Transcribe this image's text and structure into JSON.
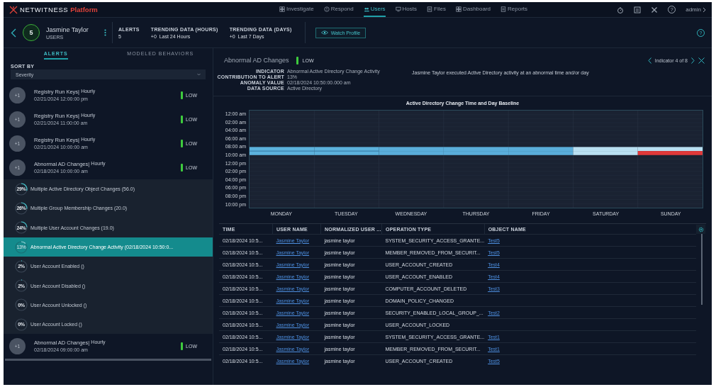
{
  "nav": {
    "logo_main": "NETWITNESS",
    "logo_accent": "Platform",
    "items": [
      {
        "label": "Investigate",
        "selected": false
      },
      {
        "label": "Respond",
        "selected": false
      },
      {
        "label": "Users",
        "selected": true
      },
      {
        "label": "Hosts",
        "selected": false
      },
      {
        "label": "Files",
        "selected": false
      },
      {
        "label": "Dashboard",
        "selected": false
      },
      {
        "label": "Reports",
        "selected": false
      }
    ],
    "help": "?",
    "user": "admin"
  },
  "profile": {
    "score": "5",
    "name": "Jasmine Taylor",
    "type": "USERS",
    "stats": [
      {
        "label": "ALERTS",
        "value": "5"
      },
      {
        "label": "TRENDING DATA (HOURS)",
        "value": "+0  Last 24 Hours"
      },
      {
        "label": "TRENDING DATA (DAYS)",
        "value": "+0  Last 7 Days"
      }
    ],
    "watch_button": "Watch Profile",
    "help": "?"
  },
  "left": {
    "tabs": [
      {
        "label": "ALERTS",
        "selected": true
      },
      {
        "label": "MODELED BEHAVIORS",
        "selected": false
      }
    ],
    "sort_label": "SORT BY",
    "sort_value": "Severity",
    "alerts": [
      {
        "badge": "+1",
        "name": "Registry Run Keys|",
        "frequency": "Hourly",
        "date": "02/21/2024 12:00:00 pm",
        "severity": "LOW"
      },
      {
        "badge": "+1",
        "name": "Registry Run Keys|",
        "frequency": "Hourly",
        "date": "02/21/2024 11:00:00 am",
        "severity": "LOW"
      },
      {
        "badge": "+1",
        "name": "Registry Run Keys|",
        "frequency": "Hourly",
        "date": "02/21/2024 10:00:00 am",
        "severity": "LOW"
      },
      {
        "badge": "+1",
        "name": "Abnormal AD Changes|",
        "frequency": "Hourly",
        "date": "02/18/2024 10:00:00 am",
        "severity": "LOW",
        "indicators": [
          {
            "percent": "29%",
            "label": "Multiple Active Directory Object Changes (56.0)",
            "selected": false
          },
          {
            "percent": "26%",
            "label": "Multiple Group Membership Changes (20.0)",
            "selected": false
          },
          {
            "percent": "24%",
            "label": "Multiple User Account Changes (19.0)",
            "selected": false
          },
          {
            "percent": "13%",
            "label": "Abnormal Active Directory Change Activity (02/18/2024 10:50:0...",
            "selected": true
          },
          {
            "percent": "2%",
            "label": "User Account Enabled ()",
            "selected": false
          },
          {
            "percent": "2%",
            "label": "User Account Disabled ()",
            "selected": false
          },
          {
            "percent": "0%",
            "label": "User Account Unlocked ()",
            "selected": false
          },
          {
            "percent": "0%",
            "label": "User Account Locked ()",
            "selected": false
          }
        ]
      },
      {
        "badge": "+1",
        "name": "Abnormal AD Changes|",
        "frequency": "Hourly",
        "date": "02/18/2024 09:00:00 am",
        "severity": "LOW"
      }
    ]
  },
  "detail": {
    "title": "Abnormal AD Changes",
    "severity": "LOW",
    "pager": "Indicator 4 of 8",
    "fields": [
      {
        "label": "INDICATOR",
        "value": "Abnormal Active Directory Change Activity"
      },
      {
        "label": "CONTRIBUTION TO ALERT",
        "value": "13%"
      },
      {
        "label": "ANOMALY VALUE",
        "value": "02/18/2024 10:50:00.000 am"
      },
      {
        "label": "DATA SOURCE",
        "value": "Active Directory"
      }
    ],
    "description": "Jasmine Taylor executed Active Directory activity at an abnormal time and/or day",
    "heatmap": {
      "title": "Active Directory Change Time and Day Baseline",
      "y_labels": [
        "12:00 am",
        "02:00 am",
        "04:00 am",
        "06:00 am",
        "08:00 am",
        "10:00 am",
        "12:00 pm",
        "02:00 pm",
        "04:00 pm",
        "06:00 pm",
        "08:00 pm",
        "10:00 pm"
      ],
      "x_labels": [
        "MONDAY",
        "TUESDAY",
        "WEDNESDAY",
        "THURSDAY",
        "FRIDAY",
        "SATURDAY",
        "SUNDAY"
      ]
    },
    "table": {
      "columns": [
        "TIME",
        "USER NAME",
        "NORMALIZED USER ...",
        "OPERATION TYPE",
        "OBJECT NAME"
      ],
      "rows": [
        {
          "time": "02/18/2024 10:5...",
          "user": "Jasmine Taylor",
          "normalized": "jasmine taylor",
          "operation": "SYSTEM_SECURITY_ACCESS_GRANTE...",
          "object": "Test5"
        },
        {
          "time": "02/18/2024 10:5...",
          "user": "Jasmine Taylor",
          "normalized": "jasmine taylor",
          "operation": "MEMBER_REMOVED_FROM_SECURIT...",
          "object": "Test5"
        },
        {
          "time": "02/18/2024 10:5...",
          "user": "Jasmine Taylor",
          "normalized": "jasmine taylor",
          "operation": "USER_ACCOUNT_CREATED",
          "object": "Test4"
        },
        {
          "time": "02/18/2024 10:5...",
          "user": "Jasmine Taylor",
          "normalized": "jasmine taylor",
          "operation": "USER_ACCOUNT_ENABLED",
          "object": "Test4"
        },
        {
          "time": "02/18/2024 10:5...",
          "user": "Jasmine Taylor",
          "normalized": "jasmine taylor",
          "operation": "COMPUTER_ACCOUNT_DELETED",
          "object": "Test3"
        },
        {
          "time": "02/18/2024 10:5...",
          "user": "Jasmine Taylor",
          "normalized": "jasmine taylor",
          "operation": "DOMAIN_POLICY_CHANGED"
        },
        {
          "time": "02/18/2024 10:5...",
          "user": "Jasmine Taylor",
          "normalized": "jasmine taylor",
          "operation": "SECURITY_ENABLED_LOCAL_GROUP_...",
          "object": "Test2"
        },
        {
          "time": "02/18/2024 10:5...",
          "user": "Jasmine Taylor",
          "normalized": "jasmine taylor",
          "operation": "USER_ACCOUNT_LOCKED"
        },
        {
          "time": "02/18/2024 10:5...",
          "user": "Jasmine Taylor",
          "normalized": "jasmine taylor",
          "operation": "SYSTEM_SECURITY_ACCESS_GRANTE...",
          "object": "Test1"
        },
        {
          "time": "02/18/2024 10:5...",
          "user": "Jasmine Taylor",
          "normalized": "jasmine taylor",
          "operation": "MEMBER_REMOVED_FROM_SECURIT...",
          "object": "Test1"
        },
        {
          "time": "02/18/2024 10:5...",
          "user": "Jasmine Taylor",
          "normalized": "jasmine taylor",
          "operation": "USER_ACCOUNT_CREATED",
          "object": "Test5"
        }
      ]
    }
  }
}
